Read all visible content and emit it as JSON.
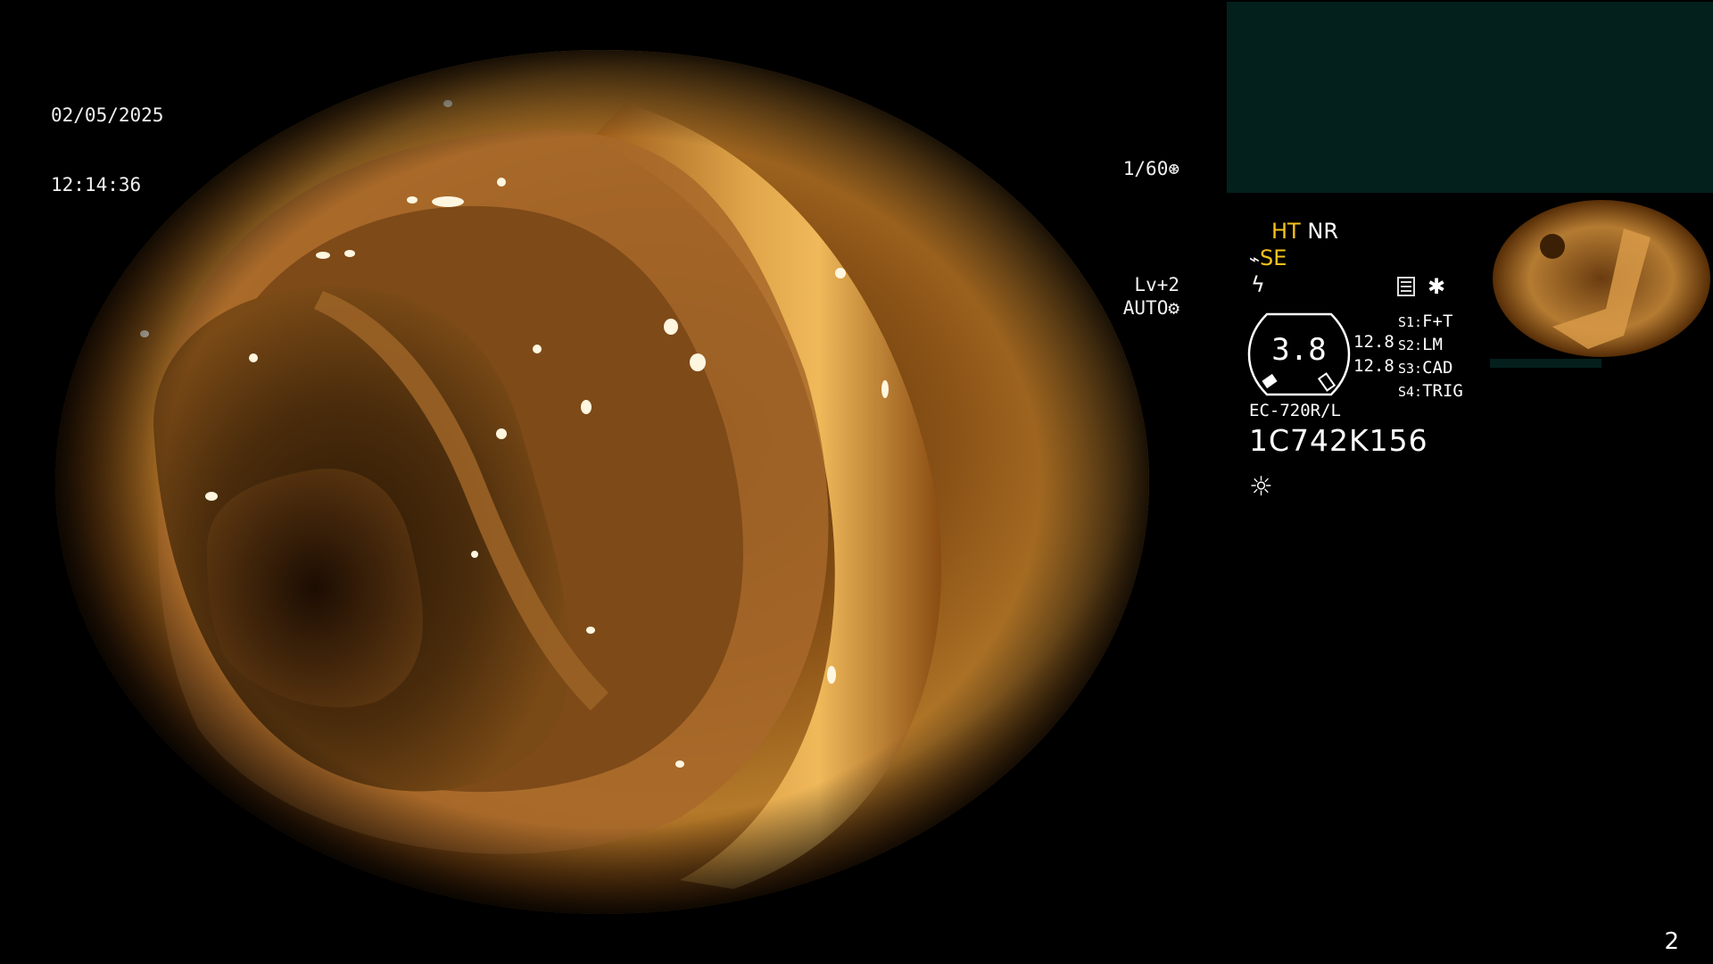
{
  "osd": {
    "date": "02/05/2025",
    "time": "12:14:36",
    "shutter": "1/60",
    "level": "Lv+2",
    "exposure_mode": "AUTO"
  },
  "status": {
    "ht": "HT",
    "nr": "NR",
    "se": "SE"
  },
  "gauge": {
    "value": "3.8",
    "left_top": "12.8",
    "left_bottom": "12.8"
  },
  "switches": [
    {
      "key": "S1:",
      "label": "F+T"
    },
    {
      "key": "S2:",
      "label": "LM"
    },
    {
      "key": "S3:",
      "label": "CAD"
    },
    {
      "key": "S4:",
      "label": "TRIG"
    }
  ],
  "scope": {
    "model": "EC-720R/L",
    "serial": "1C742K156"
  },
  "page_number": "2",
  "colors": {
    "accent_yellow": "#f7c21b",
    "panel_teal": "#03201d",
    "osd_text": "#f0f0f0"
  },
  "icons": {
    "shutter": "aperture-icon",
    "auto": "gear-icon",
    "scope_icon": "pencil-icon",
    "freeze_icon": "lightning-icon",
    "memo_icon": "document-icon",
    "star": "asterisk-icon",
    "light": "sun-icon"
  }
}
